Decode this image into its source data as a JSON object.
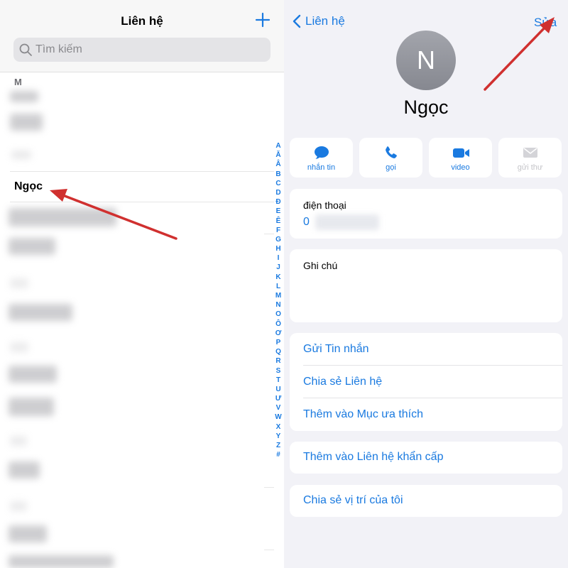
{
  "left": {
    "title": "Liên hệ",
    "add_icon": "plus-icon",
    "search_placeholder": "Tìm kiếm",
    "section": "M",
    "highlighted_contact": "Ngọc",
    "index_letters": [
      "A",
      "Ă",
      "Â",
      "B",
      "C",
      "D",
      "Đ",
      "E",
      "Ê",
      "F",
      "G",
      "H",
      "I",
      "J",
      "K",
      "L",
      "M",
      "N",
      "O",
      "Ô",
      "Ơ",
      "P",
      "Q",
      "R",
      "S",
      "T",
      "U",
      "Ư",
      "V",
      "W",
      "X",
      "Y",
      "Z",
      "#"
    ]
  },
  "right": {
    "back_label": "Liên hệ",
    "edit_label": "Sửa",
    "avatar_initial": "N",
    "contact_name": "Ngọc",
    "actions": [
      {
        "label": "nhắn tin",
        "icon": "message-icon",
        "enabled": true
      },
      {
        "label": "gọi",
        "icon": "phone-icon",
        "enabled": true
      },
      {
        "label": "video",
        "icon": "video-icon",
        "enabled": true
      },
      {
        "label": "gửi thư",
        "icon": "mail-icon",
        "enabled": false
      }
    ],
    "phone_label": "điện thoại",
    "phone_value": "0",
    "note_label": "Ghi chú",
    "links": [
      "Gửi Tin nhắn",
      "Chia sẻ Liên hệ",
      "Thêm vào Mục ưa thích"
    ],
    "emergency_label": "Thêm vào Liên hệ khẩn cấp",
    "share_location_label": "Chia sẻ vị trí của tôi"
  },
  "colors": {
    "accent": "#1a7ae0",
    "arrow": "#d0302f",
    "background": "#f2f2f7"
  }
}
